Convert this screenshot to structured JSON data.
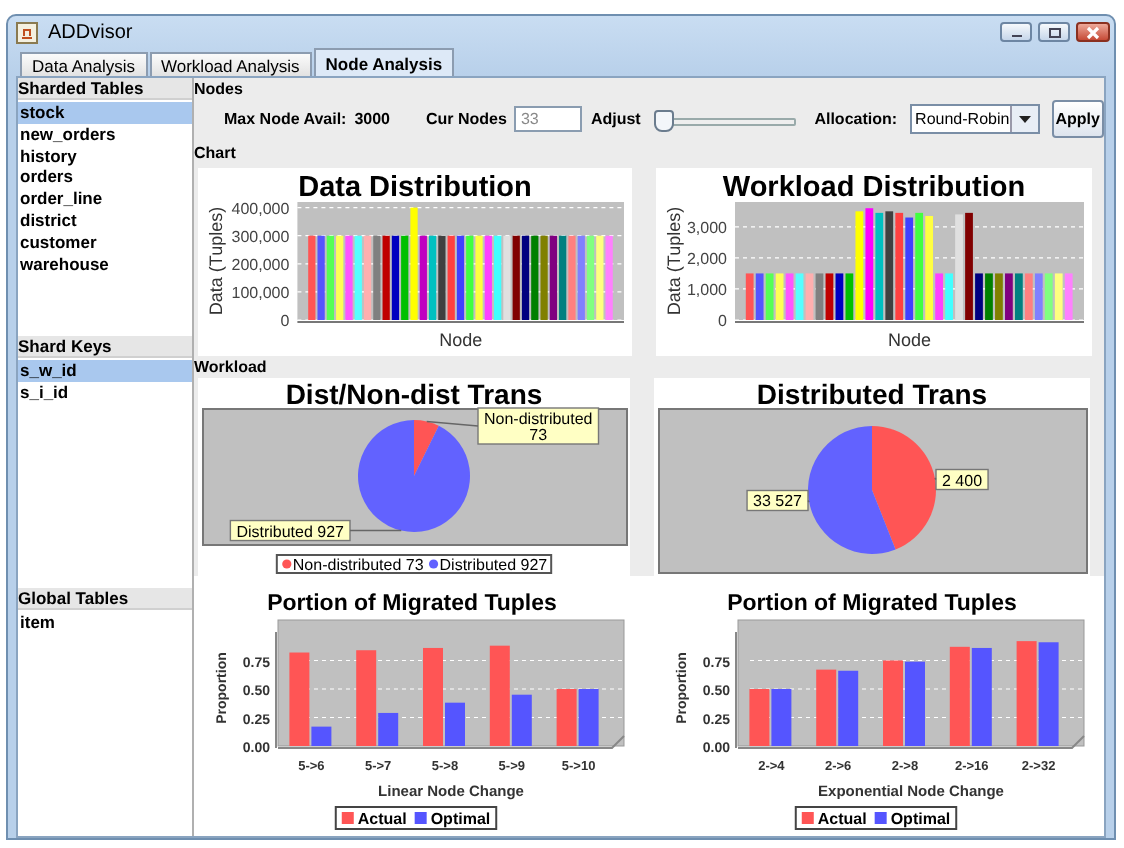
{
  "window": {
    "title": "ADDvisor"
  },
  "tabs": [
    {
      "label": "Data Analysis",
      "selected": false
    },
    {
      "label": "Workload Analysis",
      "selected": false
    },
    {
      "label": "Node Analysis",
      "selected": true
    }
  ],
  "sidebar": {
    "sections": [
      {
        "title": "Sharded Tables",
        "items": [
          {
            "label": "stock",
            "selected": true
          },
          {
            "label": "new_orders",
            "selected": false
          },
          {
            "label": "history",
            "selected": false
          },
          {
            "label": "orders",
            "selected": false
          },
          {
            "label": "order_line",
            "selected": false
          },
          {
            "label": "district",
            "selected": false
          },
          {
            "label": "customer",
            "selected": false
          },
          {
            "label": "warehouse",
            "selected": false
          }
        ]
      },
      {
        "title": "Shard Keys",
        "items": [
          {
            "label": "s_w_id",
            "selected": true
          },
          {
            "label": "s_i_id",
            "selected": false
          }
        ]
      },
      {
        "title": "Global Tables",
        "items": [
          {
            "label": "item",
            "selected": false
          }
        ]
      }
    ]
  },
  "nodes": {
    "title": "Nodes",
    "max_label": "Max Node Avail:",
    "max_value": "3000",
    "cur_label": "Cur Nodes",
    "cur_value": "33",
    "adjust_label": "Adjust",
    "adjust": {
      "level": 0
    },
    "allocation_label": "Allocation:",
    "allocation": "Round-Robin",
    "apply": "Apply"
  },
  "chart_section": {
    "title": "Chart",
    "charts": [
      {
        "chart_data": {
          "type": "bar",
          "grid": true,
          "title": "Data Distribution",
          "xlabel": "Node",
          "ylabel": "Data (Tuples)",
          "ylim": [
            0,
            420000
          ],
          "yticks": [
            0,
            {
              "value": 100000,
              "label": "100,000"
            },
            {
              "value": 200000,
              "label": "200,000"
            },
            {
              "value": 300000,
              "label": "300,000"
            },
            {
              "value": 400000,
              "label": "400,000"
            }
          ],
          "series": [
            {
              "color": "#ff5555",
              "values": [
                300000
              ]
            },
            {
              "color": "#5555ff",
              "values": [
                300000
              ]
            },
            {
              "color": "#55ff55",
              "values": [
                300000
              ]
            },
            {
              "color": "#ffff55",
              "values": [
                300000
              ]
            },
            {
              "color": "#ff55ff",
              "values": [
                300000
              ]
            },
            {
              "color": "#55ffff",
              "values": [
                300000
              ]
            },
            {
              "color": "#ffafaf",
              "values": [
                300000
              ]
            },
            {
              "color": "#808080",
              "values": [
                300000
              ]
            },
            {
              "color": "#c00000",
              "values": [
                300000
              ]
            },
            {
              "color": "#0000c0",
              "values": [
                300000
              ]
            },
            {
              "color": "#00c000",
              "values": [
                300000
              ]
            },
            {
              "color": "#ffff00",
              "values": [
                400000
              ]
            },
            {
              "color": "#c000c0",
              "values": [
                300000
              ]
            },
            {
              "color": "#00c0c0",
              "values": [
                300000
              ]
            },
            {
              "color": "#404040",
              "values": [
                300000
              ]
            },
            {
              "color": "#ff4040",
              "values": [
                300000
              ]
            },
            {
              "color": "#4040ff",
              "values": [
                300000
              ]
            },
            {
              "color": "#40ff40",
              "values": [
                300000
              ]
            },
            {
              "color": "#ffff40",
              "values": [
                300000
              ]
            },
            {
              "color": "#ff40ff",
              "values": [
                300000
              ]
            },
            {
              "color": "#40ffff",
              "values": [
                300000
              ]
            },
            {
              "color": "#e0e0e0",
              "values": [
                300000
              ]
            },
            {
              "color": "#800000",
              "values": [
                300000
              ]
            },
            {
              "color": "#000080",
              "values": [
                300000
              ]
            },
            {
              "color": "#008000",
              "values": [
                300000
              ]
            },
            {
              "color": "#808000",
              "values": [
                300000
              ]
            },
            {
              "color": "#800080",
              "values": [
                300000
              ]
            },
            {
              "color": "#008080",
              "values": [
                300000
              ]
            },
            {
              "color": "#ff8080",
              "values": [
                300000
              ]
            },
            {
              "color": "#8080ff",
              "values": [
                300000
              ]
            },
            {
              "color": "#80ff80",
              "values": [
                300000
              ]
            },
            {
              "color": "#ffff80",
              "values": [
                300000
              ]
            },
            {
              "color": "#ff80ff",
              "values": [
                300000
              ]
            }
          ]
        }
      },
      {
        "chart_data": {
          "type": "bar",
          "grid": true,
          "title": "Workload Distribution",
          "xlabel": "Node",
          "ylabel": "Data (Tuples)",
          "ylim": [
            0,
            3800
          ],
          "yticks": [
            0,
            {
              "value": 1000,
              "label": "1,000"
            },
            {
              "value": 2000,
              "label": "2,000"
            },
            {
              "value": 3000,
              "label": "3,000"
            }
          ],
          "series": [
            {
              "color": "#ff5555",
              "values": [
                1500
              ]
            },
            {
              "color": "#5555ff",
              "values": [
                1500
              ]
            },
            {
              "color": "#55ff55",
              "values": [
                1500
              ]
            },
            {
              "color": "#ffff55",
              "values": [
                1500
              ]
            },
            {
              "color": "#ff55ff",
              "values": [
                1500
              ]
            },
            {
              "color": "#55ffff",
              "values": [
                1500
              ]
            },
            {
              "color": "#ffafaf",
              "values": [
                1500
              ]
            },
            {
              "color": "#808080",
              "values": [
                1500
              ]
            },
            {
              "color": "#c00000",
              "values": [
                1500
              ]
            },
            {
              "color": "#0000c0",
              "values": [
                1500
              ]
            },
            {
              "color": "#00c000",
              "values": [
                1500
              ]
            },
            {
              "color": "#ffff00",
              "values": [
                3500
              ]
            },
            {
              "color": "#ff00ff",
              "values": [
                3600
              ]
            },
            {
              "color": "#00c0c0",
              "values": [
                3450
              ]
            },
            {
              "color": "#404040",
              "values": [
                3500
              ]
            },
            {
              "color": "#ff4040",
              "values": [
                3450
              ]
            },
            {
              "color": "#4040ff",
              "values": [
                3300
              ]
            },
            {
              "color": "#40ff40",
              "values": [
                3450
              ]
            },
            {
              "color": "#ffff40",
              "values": [
                3350
              ]
            },
            {
              "color": "#ff40ff",
              "values": [
                1500
              ]
            },
            {
              "color": "#40ffff",
              "values": [
                1500
              ]
            },
            {
              "color": "#e0e0e0",
              "values": [
                3400
              ]
            },
            {
              "color": "#800000",
              "values": [
                3450
              ]
            },
            {
              "color": "#000080",
              "values": [
                1500
              ]
            },
            {
              "color": "#008000",
              "values": [
                1500
              ]
            },
            {
              "color": "#808000",
              "values": [
                1500
              ]
            },
            {
              "color": "#800080",
              "values": [
                1500
              ]
            },
            {
              "color": "#008080",
              "values": [
                1500
              ]
            },
            {
              "color": "#ff8080",
              "values": [
                1500
              ]
            },
            {
              "color": "#8080ff",
              "values": [
                1500
              ]
            },
            {
              "color": "#80ff80",
              "values": [
                1500
              ]
            },
            {
              "color": "#ffff80",
              "values": [
                1500
              ]
            },
            {
              "color": "#ff80ff",
              "values": [
                1500
              ]
            }
          ]
        }
      }
    ]
  },
  "workload": {
    "title": "Workload",
    "pies": [
      {
        "chart_data": {
          "type": "pie",
          "title": "Dist/Non-dist Trans",
          "categories": [
            "Non-distributed 73",
            "Distributed 927"
          ],
          "values": [
            73,
            927
          ],
          "legend": "bottom"
        },
        "slices": [
          {
            "color": "#ff5555",
            "label": [
              "Non-distributed",
              "73"
            ]
          },
          {
            "color": "#6262ff",
            "label": [
              "Distributed 927"
            ]
          }
        ]
      },
      {
        "chart_data": {
          "type": "pie",
          "title": "Distributed Trans",
          "values": [
            44,
            56
          ]
        },
        "slices": [
          {
            "color": "#ff5555",
            "label": [
              "2 400"
            ]
          },
          {
            "color": "#6262ff",
            "label": [
              "33 527"
            ]
          }
        ]
      }
    ]
  },
  "migration": {
    "charts": [
      {
        "chart_data": {
          "type": "bar",
          "grid": true,
          "legend": "bottom",
          "title": "Portion of Migrated Tuples",
          "xlabel": "Linear Node Change",
          "ylabel": "Proportion",
          "categories": [
            "5->6",
            "5->7",
            "5->8",
            "5->9",
            "5->10"
          ],
          "ylim": [
            0,
            1
          ],
          "yticks": [
            {
              "value": 0,
              "label": "0.00"
            },
            {
              "value": 0.25,
              "label": "0.25"
            },
            {
              "value": 0.5,
              "label": "0.50"
            },
            {
              "value": 0.75,
              "label": "0.75"
            }
          ],
          "series": [
            {
              "name": "Actual",
              "color": "#ff5555",
              "values": [
                0.82,
                0.84,
                0.86,
                0.88,
                0.5
              ]
            },
            {
              "name": "Optimal",
              "color": "#5555ff",
              "values": [
                0.17,
                0.29,
                0.38,
                0.45,
                0.5
              ]
            }
          ]
        }
      },
      {
        "chart_data": {
          "type": "bar",
          "grid": true,
          "legend": "bottom",
          "title": "Portion of Migrated Tuples",
          "xlabel": "Exponential Node Change",
          "ylabel": "Proportion",
          "categories": [
            "2->4",
            "2->6",
            "2->8",
            "2->16",
            "2->32"
          ],
          "ylim": [
            0,
            1
          ],
          "yticks": [
            {
              "value": 0,
              "label": "0.00"
            },
            {
              "value": 0.25,
              "label": "0.25"
            },
            {
              "value": 0.5,
              "label": "0.50"
            },
            {
              "value": 0.75,
              "label": "0.75"
            }
          ],
          "series": [
            {
              "name": "Actual",
              "color": "#ff5555",
              "values": [
                0.5,
                0.67,
                0.75,
                0.87,
                0.92
              ]
            },
            {
              "name": "Optimal",
              "color": "#5555ff",
              "values": [
                0.5,
                0.66,
                0.74,
                0.86,
                0.91
              ]
            }
          ]
        }
      }
    ]
  }
}
